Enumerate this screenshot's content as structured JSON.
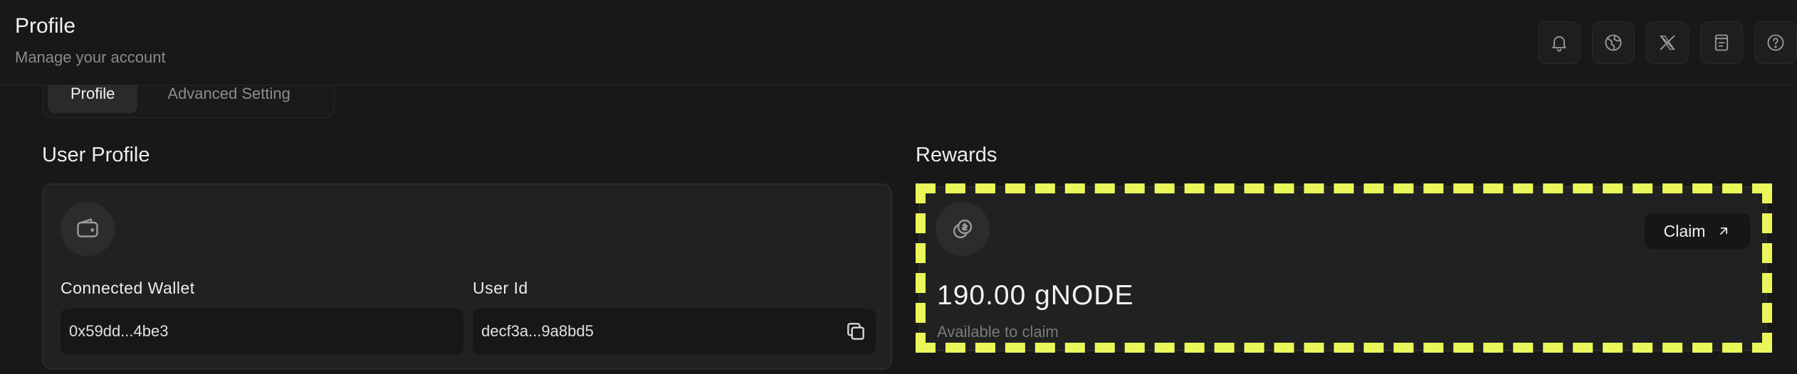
{
  "header": {
    "title": "Profile",
    "subtitle": "Manage your account",
    "icons": [
      "bell-icon",
      "globe-icon",
      "x-logo-icon",
      "docs-icon",
      "help-icon"
    ]
  },
  "tabs": [
    {
      "label": "Profile",
      "active": true
    },
    {
      "label": "Advanced Setting",
      "active": false
    }
  ],
  "user_profile": {
    "title": "User Profile",
    "wallet_label": "Connected Wallet",
    "wallet_value": "0x59dd...4be3",
    "user_id_label": "User Id",
    "user_id_value": "decf3a...9a8bd5"
  },
  "rewards": {
    "title": "Rewards",
    "claim_label": "Claim",
    "amount": "190.00 gNODE",
    "caption": "Available to claim"
  },
  "colors": {
    "background": "#181818",
    "card": "#212121",
    "highlight": "#eaf75a"
  }
}
